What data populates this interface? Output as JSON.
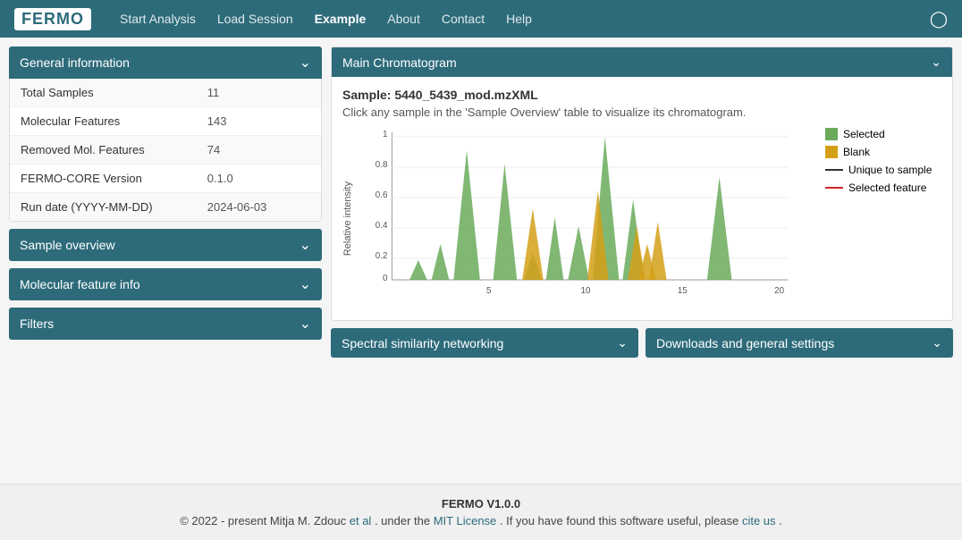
{
  "navbar": {
    "logo": "FERMO",
    "links": [
      {
        "label": "Start Analysis",
        "active": false,
        "name": "start-analysis"
      },
      {
        "label": "Load Session",
        "active": false,
        "name": "load-session"
      },
      {
        "label": "Example",
        "active": true,
        "name": "example"
      },
      {
        "label": "About",
        "active": false,
        "name": "about"
      },
      {
        "label": "Contact",
        "active": false,
        "name": "contact"
      },
      {
        "label": "Help",
        "active": false,
        "name": "help"
      }
    ]
  },
  "general_info": {
    "title": "General information",
    "rows": [
      {
        "label": "Total Samples",
        "value": "11"
      },
      {
        "label": "Molecular Features",
        "value": "143"
      },
      {
        "label": "Removed Mol. Features",
        "value": "74"
      },
      {
        "label": "FERMO-CORE Version",
        "value": "0.1.0"
      },
      {
        "label": "Run date (YYYY-MM-DD)",
        "value": "2024-06-03"
      }
    ]
  },
  "sample_overview": {
    "title": "Sample overview"
  },
  "molecular_feature_info": {
    "title": "Molecular feature info"
  },
  "filters": {
    "title": "Filters"
  },
  "chromatogram": {
    "panel_title": "Main Chromatogram",
    "sample_label": "Sample:",
    "sample_name": "5440_5439_mod.mzXML",
    "subtitle": "Click any sample in the 'Sample Overview' table to visualize its chromatogram.",
    "y_axis_label": "Relative intensity",
    "x_axis_ticks": [
      "5",
      "10",
      "15",
      "20"
    ],
    "legend": [
      {
        "type": "box",
        "color": "#6aaa5a",
        "label": "Selected"
      },
      {
        "type": "box",
        "color": "#d4a017",
        "label": "Blank"
      },
      {
        "type": "line",
        "color": "#333333",
        "label": "Unique to sample"
      },
      {
        "type": "line",
        "color": "#cc2222",
        "label": "Selected feature"
      }
    ]
  },
  "spectral_networking": {
    "title": "Spectral similarity networking"
  },
  "downloads": {
    "title": "Downloads and general settings"
  },
  "footer": {
    "title": "FERMO V1.0.0",
    "text_before": "© 2022 - present Mitja M. Zdouc",
    "et_al_label": "et al",
    "et_al_href": "#",
    "text_middle": ". under the",
    "license_label": "MIT License",
    "license_href": "#",
    "text_after": ". If you have found this software useful, please",
    "cite_label": "cite us",
    "cite_href": "#",
    "period": "."
  }
}
